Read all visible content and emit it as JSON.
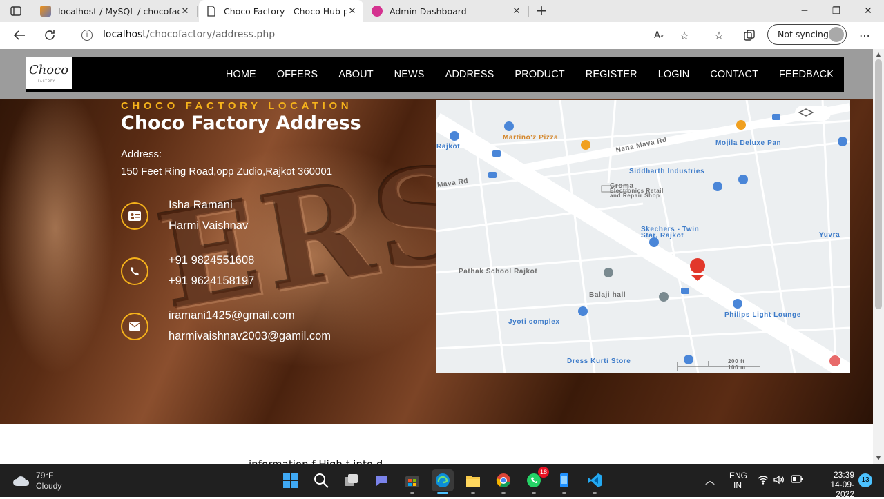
{
  "browser": {
    "tabs": [
      {
        "title": "localhost / MySQL / chocofactory",
        "favicon": "phpmyadmin-icon"
      },
      {
        "title": "Choco Factory - Choco Hub php",
        "favicon": "page-icon",
        "active": true
      },
      {
        "title": "Admin Dashboard",
        "favicon": "dashboard-icon"
      }
    ],
    "url_host": "localhost",
    "url_path": "/chocofactory/address.php",
    "sync_label": "Not syncing"
  },
  "site": {
    "logo_text": "Choco",
    "logo_sub": "FACTORY",
    "nav": [
      "HOME",
      "OFFERS",
      "ABOUT",
      "NEWS",
      "ADDRESS",
      "PRODUCT",
      "REGISTER",
      "LOGIN",
      "CONTACT",
      "FEEDBACK"
    ],
    "kicker": "CHOCO FACTORY LOCATION",
    "headline": "Choco Factory Address",
    "address_label": "Address:",
    "address_text": "150 Feet Ring Road,opp Zudio,Rajkot 360001",
    "contacts": {
      "names": [
        "Isha Ramani",
        "Harmi Vaishnav"
      ],
      "phones": [
        "+91 9824551608",
        "+91 9624158197"
      ],
      "emails": [
        "iramani1425@gmail.com",
        "harmivaishnav2003@gamil.com"
      ]
    },
    "accent_color": "#f5b21b",
    "below_snippet": "information                              f  High                                     t  into d"
  },
  "map": {
    "labels": {
      "martinoz": "Martino'z Pizza",
      "mojila": "Mojila Deluxe Pan",
      "siddharth": "Siddharth Industries",
      "croma": "Croma",
      "croma_sub1": "Electronics Retail",
      "croma_sub2": "and Repair Shop",
      "skechers1": "Skechers - Twin",
      "skechers2": "Star, Rajkot",
      "pathak": "Pathak School Rajkot",
      "balaji": "Balaji hall",
      "philips": "Philips Light Lounge",
      "jyoti": "Jyoti complex",
      "dress": "Dress Kurti Store",
      "nanamava": "Nana Mava Rd",
      "mavard": "Mava Rd",
      "rajkot": "Rajkot",
      "yuvra": "Yuvra",
      "scale1": "200 ft",
      "scale2": "100 m"
    }
  },
  "taskbar": {
    "temp": "79°F",
    "condition": "Cloudy",
    "whatsapp_badge": "18",
    "lang1": "ENG",
    "lang2": "IN",
    "time": "23:39",
    "date": "14-09-2022",
    "notifications": "13"
  }
}
